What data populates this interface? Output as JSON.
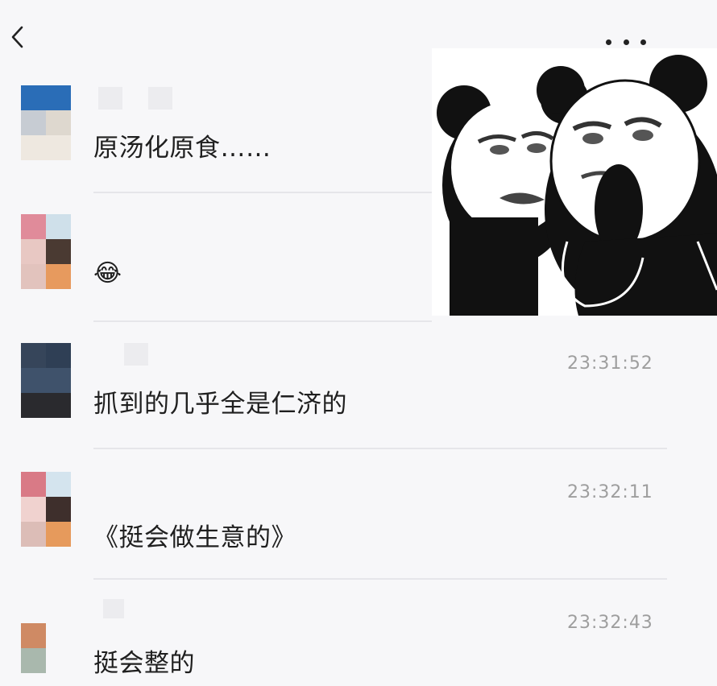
{
  "header": {
    "back_icon": "chevron-left-icon",
    "more_icon": "more-dots-icon"
  },
  "messages": [
    {
      "text": "原汤化原食……",
      "time": ""
    },
    {
      "text": "😂",
      "time": "",
      "emoji_icon": "laughing-face-emoji"
    },
    {
      "text": "抓到的几乎全是仁济的",
      "time": "23:31:52"
    },
    {
      "text": "《挺会做生意的》",
      "time": "23:32:11"
    },
    {
      "text": "挺会整的",
      "time": "23:32:43"
    }
  ],
  "sticker": {
    "icon": "panda-meme-sticker"
  },
  "colors": {
    "background": "#f7f7f9",
    "text": "#1f1f1f",
    "timestamp": "#9e9e9e"
  }
}
